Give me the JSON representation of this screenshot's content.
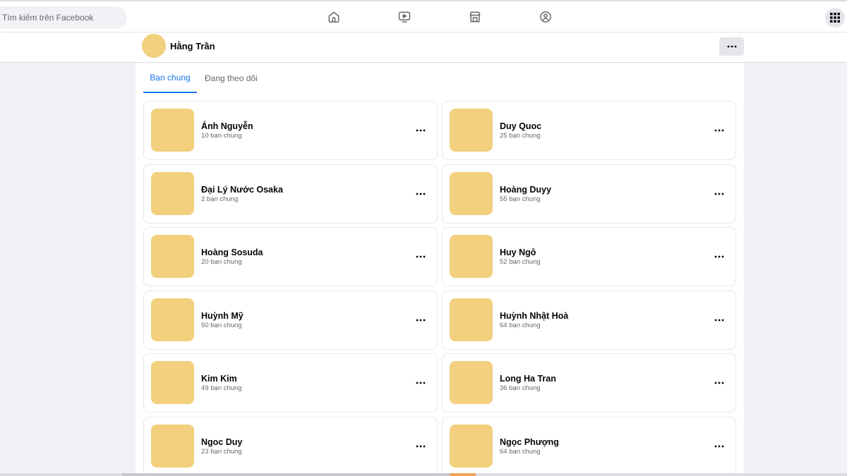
{
  "search": {
    "placeholder": "Tìm kiếm trên Facebook"
  },
  "nav": {
    "icons": [
      "home-icon",
      "watch-icon",
      "marketplace-icon",
      "groups-icon"
    ],
    "menu_icon": "grid-menu-icon"
  },
  "profile": {
    "name": "Hằng Trần"
  },
  "tabs": [
    {
      "label": "Bạn chung",
      "active": true
    },
    {
      "label": "Đang theo dõi",
      "active": false
    }
  ],
  "friends": [
    {
      "name": "Ánh Nguyễn",
      "mutual": "10 bạn chung"
    },
    {
      "name": "Duy Quoc",
      "mutual": "25 bạn chung"
    },
    {
      "name": "Đại Lý Nước Osaka",
      "mutual": "2 bạn chung"
    },
    {
      "name": "Hoàng Duyy",
      "mutual": "55 bạn chung"
    },
    {
      "name": "Hoàng Sosuda",
      "mutual": "20 bạn chung"
    },
    {
      "name": "Huy Ngô",
      "mutual": "52 bạn chung"
    },
    {
      "name": "Huỳnh Mỹ",
      "mutual": "50 bạn chung"
    },
    {
      "name": "Huỳnh Nhật Hoà",
      "mutual": "64 bạn chung"
    },
    {
      "name": "Kim Kim",
      "mutual": "49 bạn chung"
    },
    {
      "name": "Long Ha Tran",
      "mutual": "36 bạn chung"
    },
    {
      "name": "Ngoc Duy",
      "mutual": "23 bạn chung"
    },
    {
      "name": "Ngọc Phượng",
      "mutual": "64 bạn chung"
    }
  ],
  "colors": {
    "accent": "#1877f2",
    "avatar_placeholder": "#f2d07e",
    "page_background": "#f0f2f5"
  }
}
